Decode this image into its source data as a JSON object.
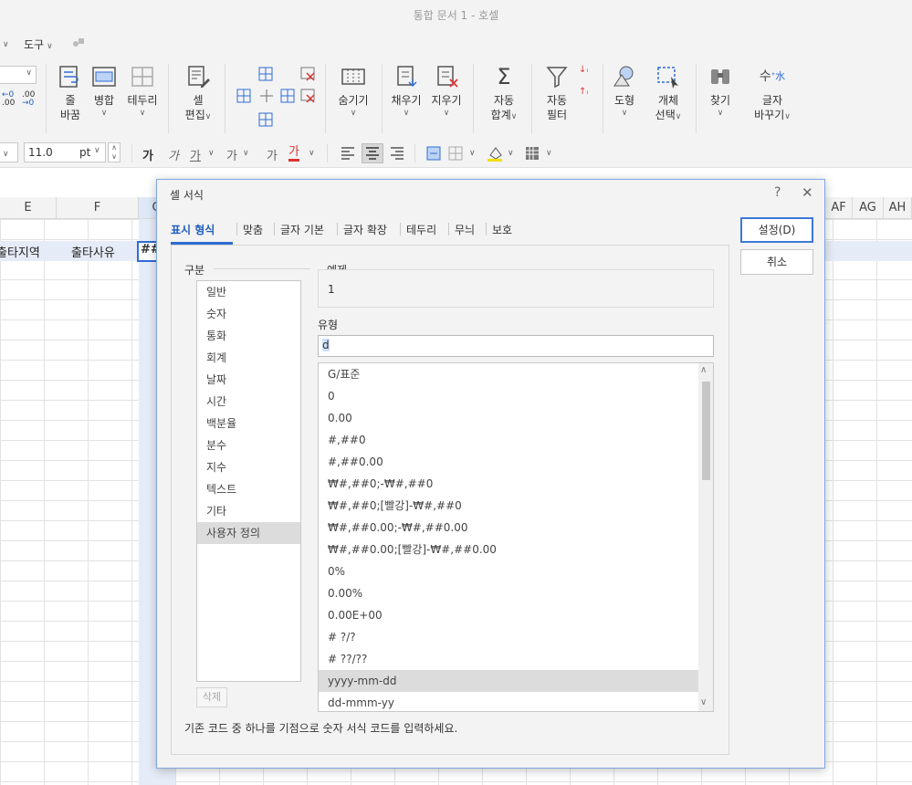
{
  "window": {
    "title": "통합 문서 1 - 호셀"
  },
  "menu": {
    "items": [
      "도구"
    ]
  },
  "ribbon": {
    "buttons": [
      {
        "id": "merge-split",
        "line1": "줄",
        "line2": "바꿈"
      },
      {
        "id": "merge",
        "line1": "병합",
        "line2": ""
      },
      {
        "id": "border",
        "line1": "테두리",
        "line2": ""
      },
      {
        "id": "cell-edit",
        "line1": "셀",
        "line2": "편집"
      },
      {
        "id": "hide",
        "line1": "숨기기",
        "line2": ""
      },
      {
        "id": "fill",
        "line1": "채우기",
        "line2": ""
      },
      {
        "id": "clear",
        "line1": "지우기",
        "line2": ""
      },
      {
        "id": "autosum",
        "line1": "자동",
        "line2": "합계"
      },
      {
        "id": "autofilter",
        "line1": "자동",
        "line2": "필터"
      },
      {
        "id": "shape",
        "line1": "도형",
        "line2": ""
      },
      {
        "id": "select-object",
        "line1": "개체",
        "line2": "선택"
      },
      {
        "id": "find",
        "line1": "찾기",
        "line2": ""
      },
      {
        "id": "replace",
        "line1": "글자",
        "line2": "바꾸기"
      }
    ]
  },
  "formatbar": {
    "font_size": "11.0",
    "unit": "pt",
    "glyphs": [
      "가",
      "가",
      "가",
      "가",
      "가",
      "가"
    ]
  },
  "sheet": {
    "columns_left": [
      "E",
      "F",
      "G"
    ],
    "columns_right": [
      "AF",
      "AG",
      "AH"
    ],
    "row_values": {
      "e": "출타지역",
      "f": "출타사유",
      "g": "##"
    }
  },
  "dialog": {
    "title": "셀 서식",
    "help": "?",
    "close": "✕",
    "tabs": [
      "표시 형식",
      "맞춤",
      "글자 기본",
      "글자 확장",
      "테두리",
      "무늬",
      "보호"
    ],
    "ok_label": "설정(D)",
    "cancel_label": "취소",
    "category_label": "구분",
    "categories": [
      "일반",
      "숫자",
      "통화",
      "회계",
      "날짜",
      "시간",
      "백분율",
      "분수",
      "지수",
      "텍스트",
      "기타",
      "사용자 정의"
    ],
    "selected_category": "사용자 정의",
    "preview_label": "예제",
    "preview_value": "1",
    "type_label": "유형",
    "type_value": "d",
    "formats": [
      "G/표준",
      "0",
      "0.00",
      "#,##0",
      "#,##0.00",
      "₩#,##0;-₩#,##0",
      "₩#,##0;[빨강]-₩#,##0",
      "₩#,##0.00;-₩#,##0.00",
      "₩#,##0.00;[빨강]-₩#,##0.00",
      "0%",
      "0.00%",
      "0.00E+00",
      "# ?/?",
      "# ??/??",
      "yyyy-mm-dd",
      "dd-mmm-yy"
    ],
    "selected_format": "yyyy-mm-dd",
    "delete_label": "삭제",
    "hint": "기존 코드 중 하나를 기점으로 숫자 서식 코드를 입력하세요."
  }
}
